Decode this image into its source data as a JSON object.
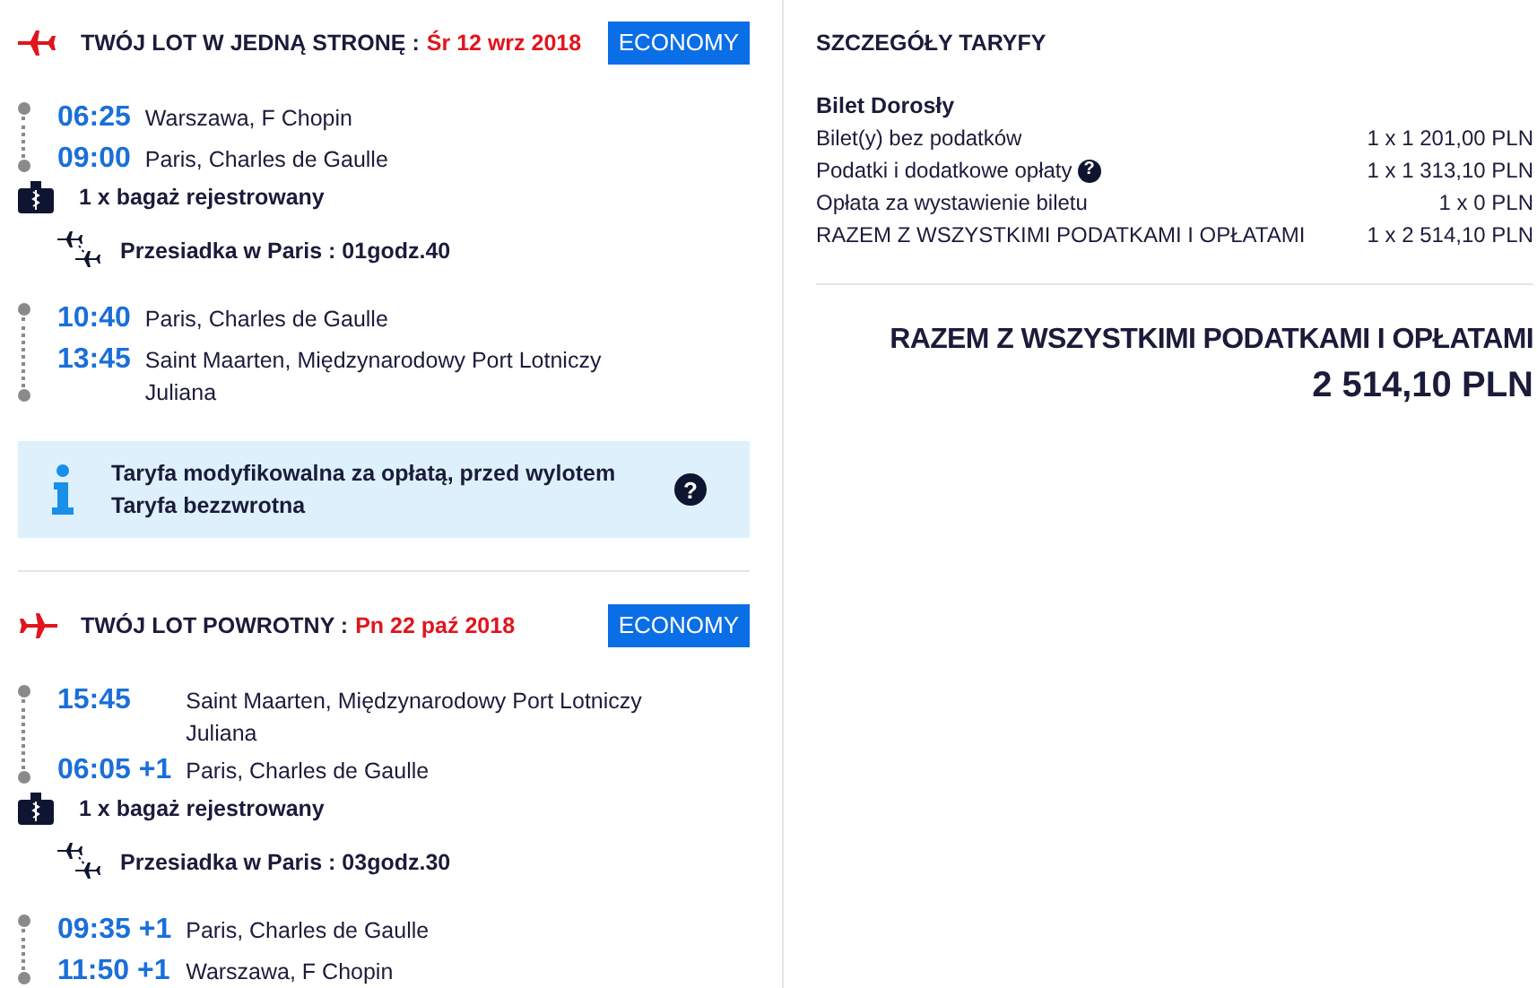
{
  "flights": [
    {
      "kind": "outbound",
      "title": "TWÓJ LOT W JEDNĄ STRONĘ :",
      "date": "Śr 12 wrz 2018",
      "cabin": "ECONOMY",
      "items": [
        {
          "kind": "segment",
          "stops": [
            {
              "time": "06:25",
              "place": "Warszawa, F Chopin"
            },
            {
              "time": "09:00",
              "place": "Paris, Charles de Gaulle"
            }
          ]
        },
        {
          "kind": "baggage",
          "text": "1 x bagaż rejestrowany"
        },
        {
          "kind": "connection",
          "text": "Przesiadka w Paris : 01godz.40"
        },
        {
          "kind": "segment",
          "stops": [
            {
              "time": "10:40",
              "place": "Paris, Charles de Gaulle"
            },
            {
              "time": "13:45",
              "place": "Saint Maarten, Międzynarodowy Port Lotniczy Juliana"
            }
          ]
        },
        {
          "kind": "info",
          "lines": [
            "Taryfa modyfikowalna za opłatą, przed wylotem",
            "Taryfa bezzwrotna"
          ],
          "help": "?"
        }
      ]
    },
    {
      "kind": "return",
      "title": "TWÓJ LOT POWROTNY :",
      "date": "Pn 22 paź 2018",
      "cabin": "ECONOMY",
      "items": [
        {
          "kind": "segment",
          "stops": [
            {
              "time": "15:45",
              "place": "Saint Maarten, Międzynarodowy Port Lotniczy Juliana"
            },
            {
              "time": "06:05 +1",
              "place": "Paris, Charles de Gaulle"
            }
          ]
        },
        {
          "kind": "baggage",
          "text": "1 x bagaż rejestrowany"
        },
        {
          "kind": "connection",
          "text": "Przesiadka w Paris : 03godz.30"
        },
        {
          "kind": "segment",
          "stops": [
            {
              "time": "09:35 +1",
              "place": "Paris, Charles de Gaulle"
            },
            {
              "time": "11:50 +1",
              "place": "Warszawa, F Chopin"
            }
          ]
        }
      ]
    }
  ],
  "fare": {
    "title": "SZCZEGÓŁY TARYFY",
    "passenger": "Bilet Dorosły",
    "rows": [
      {
        "label": "Bilet(y) bez podatków",
        "value": "1 x 1 201,00 PLN"
      },
      {
        "label": "Podatki i dodatkowe opłaty",
        "help": "?",
        "value": "1 x 1 313,10 PLN"
      },
      {
        "label": "Opłata za wystawienie biletu",
        "value": "1 x 0 PLN"
      },
      {
        "label": "RAZEM Z WSZYSTKIMI PODATKAMI I OPŁATAMI",
        "value": "1 x 2 514,10 PLN"
      }
    ],
    "total_label": "RAZEM Z WSZYSTKIMI PODATKAMI I OPŁATAMI",
    "total_value": "2 514,10 PLN"
  }
}
